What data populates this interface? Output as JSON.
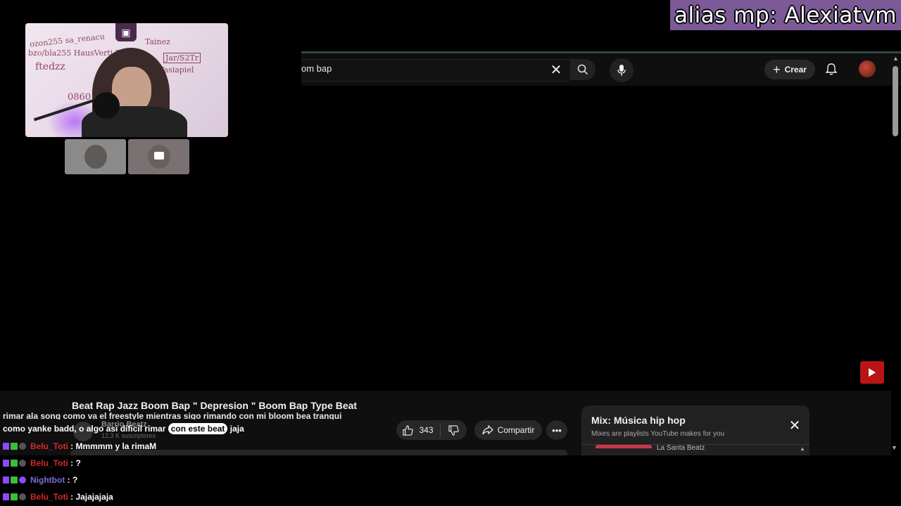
{
  "overlay": {
    "alias_banner": "alias mp: Alexiatvm"
  },
  "youtube": {
    "search_query": "om bap",
    "create_label": "Crear",
    "video_title": "Beat Rap Jazz Boom Bap \" Depresion \" Boom Bap Type Beat",
    "channel_name": "Barrio Beatz",
    "channel_subs": "12,3 K suscriptores",
    "like_count": "343",
    "share_label": "Compartir",
    "mix": {
      "title": "Mix: Música hip hop",
      "subtitle": "Mixes are playlists YouTube makes for you",
      "first_item_channel": "La Santa Beatz"
    }
  },
  "captions": {
    "line1": "rimar ala song como va el freestyle mientras sigo rimando con mi bloom bea tranqui",
    "line2_start": "como yanke badd, o algo asi dificil rimar ",
    "line2_highlight": "con este beat",
    "line2_end": " jaja"
  },
  "chat": [
    {
      "user": "Belu_Toti",
      "user_color": "#d12b2b",
      "message": " : Mmmmm y la rimaM",
      "bot": false
    },
    {
      "user": "Belu_Toti",
      "user_color": "#d12b2b",
      "message": " : ?",
      "bot": false
    },
    {
      "user": "Nightbot",
      "user_color": "#7e6bdc",
      "message": " : ?",
      "bot": true
    },
    {
      "user": "Belu_Toti",
      "user_color": "#d12b2b",
      "message": " : Jajajajaja",
      "bot": false
    }
  ]
}
